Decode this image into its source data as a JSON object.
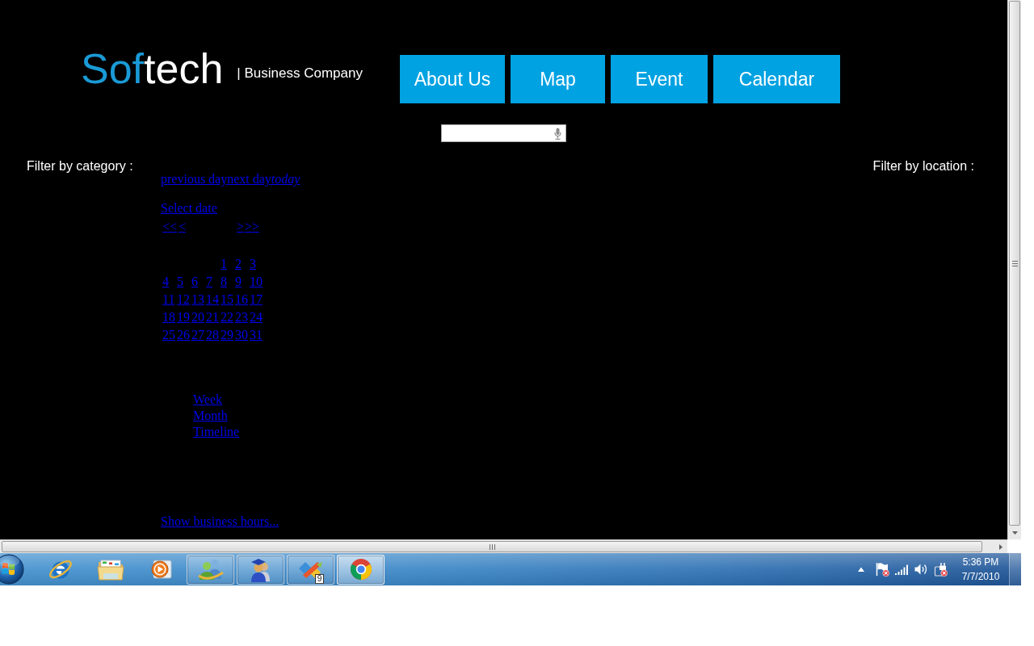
{
  "header": {
    "logo": {
      "accent": "Sof",
      "rest": "tech"
    },
    "tagline": "| Business Company"
  },
  "nav": [
    {
      "label": "About Us"
    },
    {
      "label": "Map"
    },
    {
      "label": "Event"
    },
    {
      "label": "Calendar"
    }
  ],
  "search": {
    "voice_input": true
  },
  "filters": {
    "category_label": "Filter by category :",
    "location_label": "Filter by location :"
  },
  "day_nav": [
    {
      "label": "previous day",
      "kind": "step"
    },
    {
      "label": "next day",
      "kind": "step"
    },
    {
      "label": "today",
      "kind": "today"
    }
  ],
  "date_picker": {
    "title": "Select date",
    "prev_links": [
      "<<",
      "<"
    ],
    "next_links": [
      ">",
      ">>"
    ],
    "weeks": [
      [
        "1",
        "2",
        "3"
      ],
      [
        "4",
        "5",
        "6",
        "7",
        "8",
        "9",
        "10"
      ],
      [
        "11",
        "12",
        "13",
        "14",
        "15",
        "16",
        "17"
      ],
      [
        "18",
        "19",
        "20",
        "21",
        "22",
        "23",
        "24"
      ],
      [
        "25",
        "26",
        "27",
        "28",
        "29",
        "30",
        "31"
      ]
    ]
  },
  "views": [
    {
      "label": "Week"
    },
    {
      "label": "Month"
    },
    {
      "label": "Timeline"
    }
  ],
  "business_hours_link": "Show business hours...",
  "taskbar": {
    "apps": [
      {
        "kind": "eglobe",
        "open": false,
        "active": false
      },
      {
        "kind": "folder",
        "open": false,
        "active": false
      },
      {
        "kind": "play",
        "open": false,
        "active": false
      },
      {
        "kind": "buddies",
        "open": true,
        "active": false
      },
      {
        "kind": "graduates",
        "open": true,
        "active": false
      },
      {
        "kind": "tools",
        "open": true,
        "active": false,
        "badge": "9"
      },
      {
        "kind": "wheel",
        "open": true,
        "active": true
      }
    ],
    "tray": [
      {
        "kind": "caret",
        "alert": false
      },
      {
        "kind": "flag",
        "alert": true
      },
      {
        "kind": "signal",
        "alert": false
      },
      {
        "kind": "speaker",
        "alert": false
      },
      {
        "kind": "plug",
        "alert": true
      }
    ],
    "clock": {
      "time": "5:36 PM",
      "date": "7/7/2010"
    }
  }
}
